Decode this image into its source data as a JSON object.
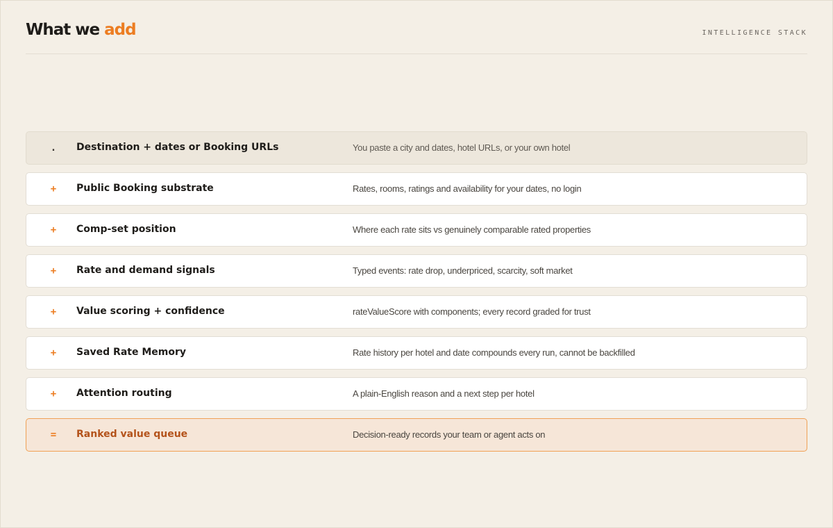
{
  "header": {
    "title_main": "What we",
    "title_accent": "add",
    "eyebrow": "INTELLIGENCE STACK"
  },
  "colors": {
    "accent": "#ec7d22",
    "background": "#f4efe6",
    "output_border": "#f0a155",
    "output_text": "#b4531b"
  },
  "stack": {
    "input": {
      "symbol": ".",
      "label": "Destination + dates or Booking URLs",
      "description": "You paste a city and dates, hotel URLs, or your own hotel"
    },
    "layers": [
      {
        "symbol": "+",
        "label": "Public Booking substrate",
        "description": "Rates, rooms, ratings and availability for your dates, no login"
      },
      {
        "symbol": "+",
        "label": "Comp-set position",
        "description": "Where each rate sits vs genuinely comparable rated properties"
      },
      {
        "symbol": "+",
        "label": "Rate and demand signals",
        "description": "Typed events: rate drop, underpriced, scarcity, soft market"
      },
      {
        "symbol": "+",
        "label": "Value scoring + confidence",
        "description": "rateValueScore with components; every record graded for trust"
      },
      {
        "symbol": "+",
        "label": "Saved Rate Memory",
        "description": "Rate history per hotel and date compounds every run, cannot be backfilled"
      },
      {
        "symbol": "+",
        "label": "Attention routing",
        "description": "A plain-English reason and a next step per hotel"
      }
    ],
    "output": {
      "symbol": "=",
      "label": "Ranked value queue",
      "description": "Decision-ready records your team or agent acts on"
    }
  }
}
